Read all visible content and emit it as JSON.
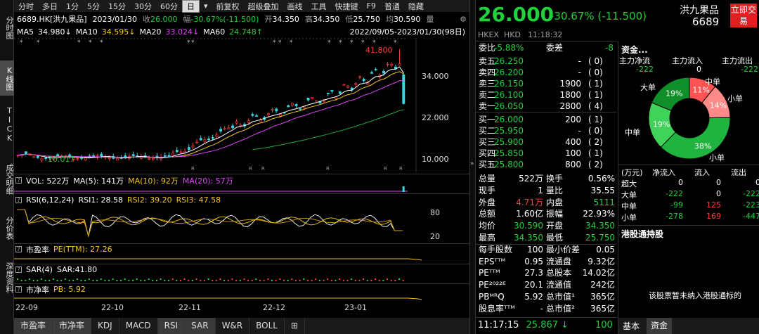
{
  "left_tabs": [
    "分时图",
    "K线图",
    "TICK",
    "成交明细",
    "分价表",
    "深度资料"
  ],
  "toolbar": {
    "items": [
      "分时",
      "多日",
      "1分",
      "5分",
      "15分",
      "30分",
      "60分",
      "日",
      "▾",
      "前复权",
      "超级叠加",
      "画线",
      "工具",
      "快捷键",
      "F9",
      "普通",
      "隐藏"
    ],
    "selected": "日"
  },
  "info": {
    "code": "6689.HK[洪九果品]",
    "date": "2023/01/30",
    "close_label": "收",
    "close": "26.000",
    "change_label": "幅",
    "change": "-30.67%(-11.500)",
    "open_label": "开",
    "open": "34.350",
    "high_label": "高",
    "high": "34.350",
    "low_label": "低",
    "low": "25.750",
    "avg_label": "均",
    "avg": "30.590",
    "vol_label": "量"
  },
  "ma": {
    "ma5_label": "MA5",
    "ma5": "34.980↓",
    "ma10_label": "MA10",
    "ma10": "34.595↓",
    "ma20_label": "MA20",
    "ma20": "33.024↓",
    "ma60_label": "MA60",
    "ma60": "24.748↑",
    "range": "2022/09/05-2023/01/30(98日)"
  },
  "price_axis": [
    "34.000",
    "22.000",
    "10.000"
  ],
  "chart_labels": {
    "high_mark": "41.800",
    "low_mark": "10.017"
  },
  "volume": {
    "label": "VOL: 522万",
    "ma5": "MA(5): 141万",
    "ma10": "MA(10): 92万",
    "ma20": "MA(20): 57万"
  },
  "rsi": {
    "label": "RSI(6,12,24)",
    "rsi1": "RSI1: 28.58",
    "rsi2": "RSI2: 39.20",
    "rsi3": "RSI3: 47.58",
    "axis": [
      "80",
      "20"
    ]
  },
  "pe": {
    "label": "市盈率",
    "value": "PE(TTM): 27.26"
  },
  "sar": {
    "label": "SAR(4)",
    "value": "SAR:41.80"
  },
  "pb": {
    "label": "市净率",
    "value": "PB: 5.92"
  },
  "x_axis": [
    "22-09",
    "22-10",
    "22-11",
    "22-12",
    "23-01"
  ],
  "bottom_tabs": [
    "市盈率",
    "市净率",
    "KDJ",
    "MACD",
    "RSI",
    "SAR",
    "W&R",
    "BOLL",
    "⊞"
  ],
  "quote": {
    "price": "26.000",
    "change": "-30.67% (-11.500)",
    "name": "洪九果品",
    "code": "6689",
    "exchange": "HKEX",
    "currency": "HKD",
    "time": "11:18:32",
    "trade_btn": "立即交易"
  },
  "order_book": {
    "weibi_label": "委比",
    "weibi": "-5.88%",
    "weicha_label": "委差",
    "weicha": "-8",
    "asks": [
      {
        "label": "卖五",
        "price": "26.250",
        "vol": "-",
        "cnt": "( 0)"
      },
      {
        "label": "卖四",
        "price": "26.200",
        "vol": "-",
        "cnt": "( 0)"
      },
      {
        "label": "卖三",
        "price": "26.150",
        "vol": "1900",
        "cnt": "( 1)"
      },
      {
        "label": "卖二",
        "price": "26.100",
        "vol": "1800",
        "cnt": "( 1)"
      },
      {
        "label": "卖一",
        "price": "26.050",
        "vol": "2800",
        "cnt": "( 4)"
      }
    ],
    "bids": [
      {
        "label": "买一",
        "price": "26.000",
        "vol": "200",
        "cnt": "( 1)"
      },
      {
        "label": "买二",
        "price": "25.950",
        "vol": "-",
        "cnt": "( 0)"
      },
      {
        "label": "买三",
        "price": "25.900",
        "vol": "400",
        "cnt": "( 2)"
      },
      {
        "label": "买四",
        "price": "25.850",
        "vol": "100",
        "cnt": "( 1)"
      },
      {
        "label": "买五",
        "price": "25.800",
        "vol": "800",
        "cnt": "( 2)"
      }
    ]
  },
  "stats": [
    {
      "l1": "总量",
      "v1": "522万",
      "l2": "换手",
      "v2": "0.56%",
      "c1": "white",
      "c2": "white"
    },
    {
      "l1": "现手",
      "v1": "1",
      "l2": "量比",
      "v2": "35.55",
      "c1": "white",
      "c2": "white"
    },
    {
      "l1": "外盘",
      "v1": "4.71万",
      "l2": "内盘",
      "v2": "5111",
      "c1": "red",
      "c2": "green"
    },
    {
      "l1": "总额",
      "v1": "1.60亿",
      "l2": "振幅",
      "v2": "22.93%",
      "c1": "white",
      "c2": "white"
    },
    {
      "l1": "均价",
      "v1": "30.590",
      "l2": "开盘",
      "v2": "34.350",
      "c1": "green",
      "c2": "green"
    },
    {
      "l1": "最高",
      "v1": "34.350",
      "l2": "最低",
      "v2": "25.750",
      "c1": "green",
      "c2": "green"
    },
    {
      "l1": "每手股数",
      "v1": "100",
      "l2": "最小价差",
      "v2": "0.05",
      "c1": "white",
      "c2": "white"
    },
    {
      "l1": "EPSᵀᵀᴹ",
      "v1": "0.95",
      "l2": "流通盘",
      "v2": "9.32亿",
      "c1": "white",
      "c2": "white"
    },
    {
      "l1": "PEᵀᵀᴹ",
      "v1": "27.3",
      "l2": "总股本",
      "v2": "14.02亿",
      "c1": "white",
      "c2": "white"
    },
    {
      "l1": "PE²⁰²²ᴱ",
      "v1": "20.1",
      "l2": "流通值",
      "v2": "242亿",
      "c1": "white",
      "c2": "white"
    },
    {
      "l1": "PBᴹᴿQ",
      "v1": "5.92",
      "l2": "总市值¹",
      "v2": "365亿",
      "c1": "white",
      "c2": "white"
    },
    {
      "l1": "股息率ᵀᵀᴹ",
      "v1": "-",
      "l2": "总市值²",
      "v2": "365亿",
      "c1": "white",
      "c2": "white"
    }
  ],
  "last_tick": {
    "time": "11:17:15",
    "price": "25.867",
    "arrow": "↓",
    "vol": "100"
  },
  "funds": {
    "title": "资金...",
    "flow_labels": [
      "主力净流",
      "主力流入",
      "主力流出"
    ],
    "flow_values": [
      "-222",
      "0",
      "-222"
    ],
    "pie": {
      "labels": {
        "super": "中单",
        "big": "大单",
        "small_r": "小单",
        "mid_l": "中单",
        "small_b": "小单"
      },
      "slices": [
        {
          "name": "11%",
          "value": 11,
          "color": "#ff5252"
        },
        {
          "name": "14%",
          "value": 14,
          "color": "#ff8a8a"
        },
        {
          "name": "38%",
          "value": 38,
          "color": "#21b33f"
        },
        {
          "name": "19%",
          "value": 19,
          "color": "#3fd35a"
        },
        {
          "name": "19%",
          "value": 19,
          "color": "#0f8f2a"
        }
      ]
    },
    "table_head": [
      "(万元)",
      "净流入",
      "流入",
      "流出"
    ],
    "table_rows": [
      {
        "k": "超大",
        "a": "0",
        "b": "0",
        "c": "0"
      },
      {
        "k": "大单",
        "a": "-222",
        "b": "0",
        "c": "-222"
      },
      {
        "k": "中单",
        "a": "-99",
        "b": "125",
        "c": "-223"
      },
      {
        "k": "小单",
        "a": "-278",
        "b": "169",
        "c": "-447"
      }
    ],
    "hk_connect_title": "港股通持股",
    "hk_connect_note": "该股票暂未纳入港股通标的",
    "tabs": [
      "基本",
      "资金"
    ]
  }
}
